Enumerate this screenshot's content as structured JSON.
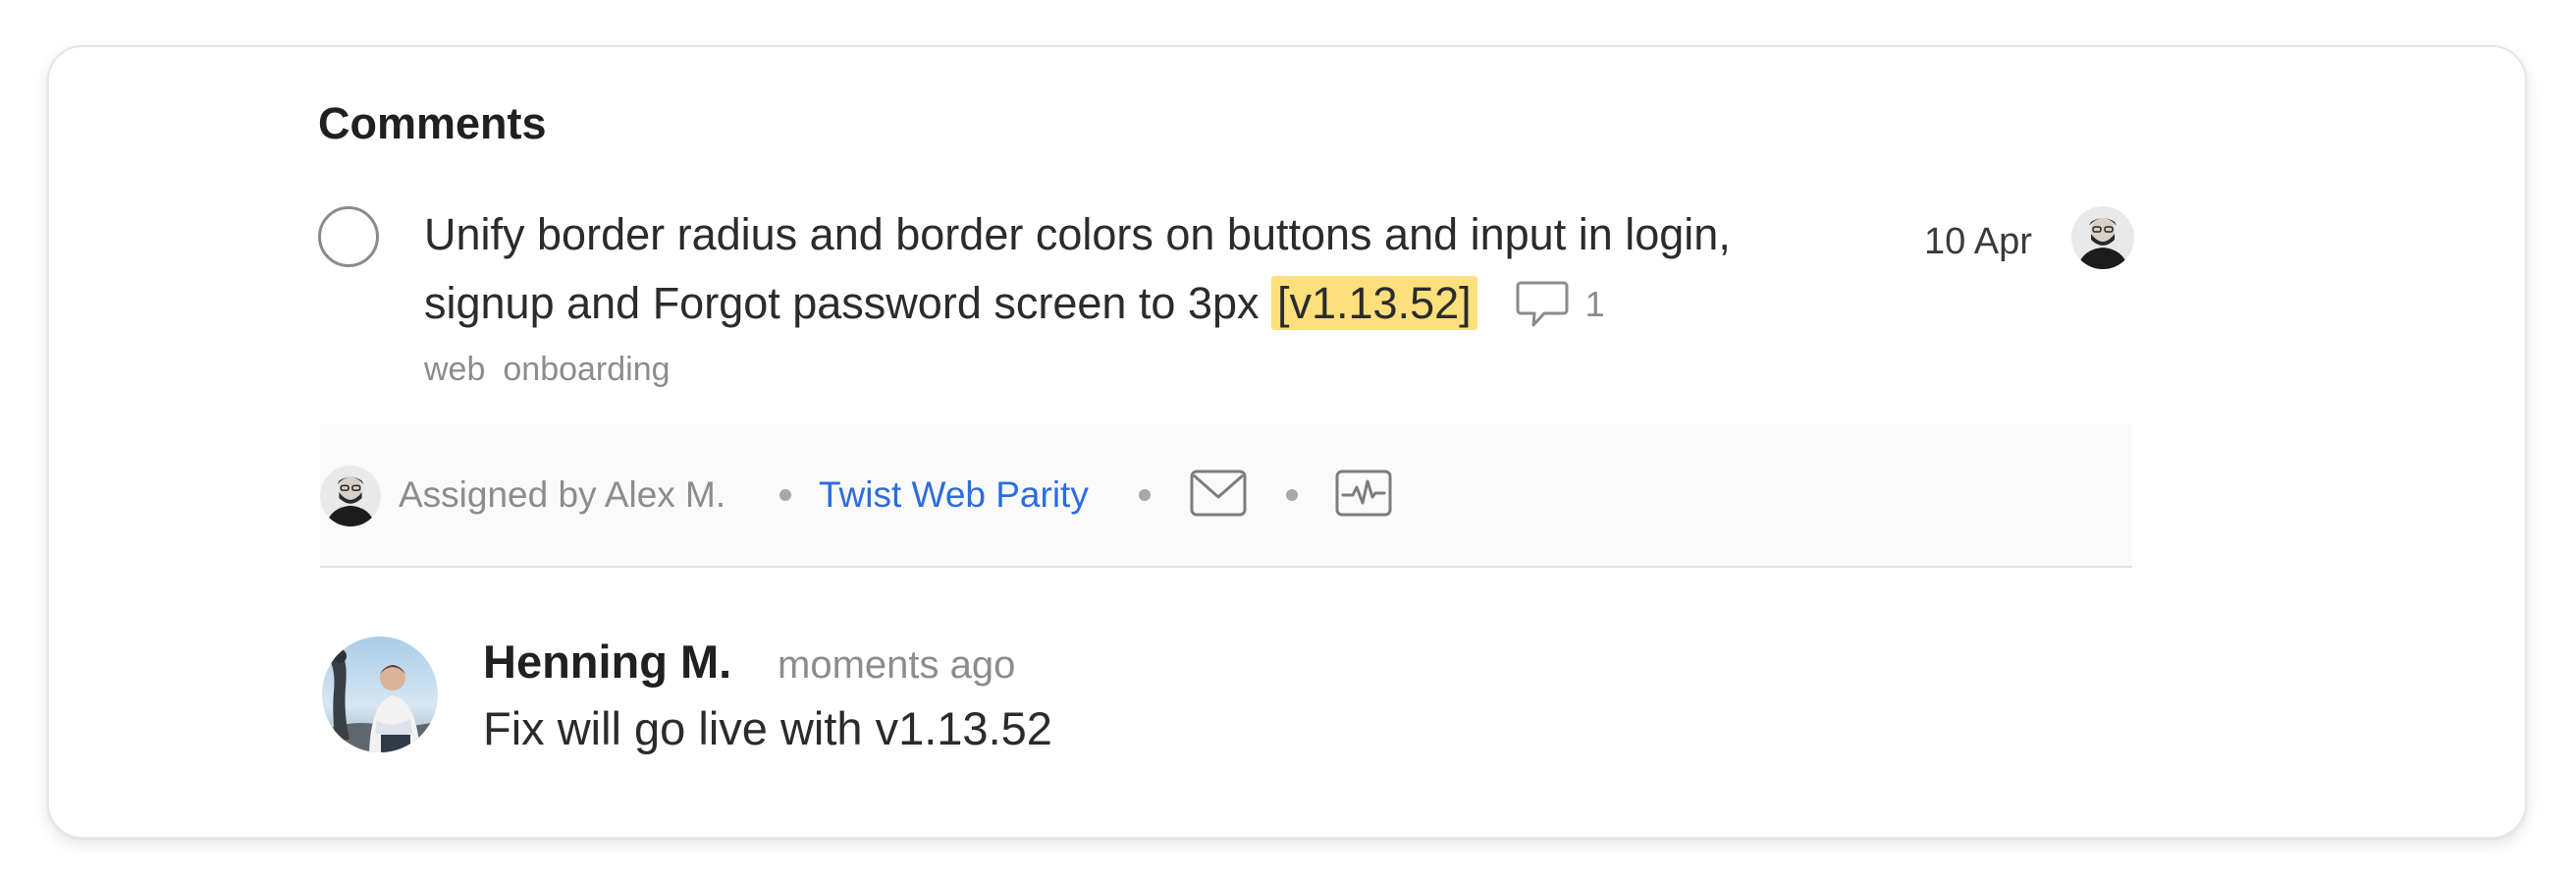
{
  "section": {
    "title": "Comments"
  },
  "task": {
    "line1": "Unify border radius and border colors on buttons and input in login,",
    "line2_prefix": "signup and Forgot password screen to 3px ",
    "version_tag": "[v1.13.52]",
    "comment_count": "1",
    "date": "10 Apr",
    "labels": [
      "web",
      "onboarding"
    ]
  },
  "meta": {
    "assigned_by": "Assigned by Alex M.",
    "project": "Twist Web Parity",
    "icons": [
      "mail-icon",
      "activity-icon"
    ]
  },
  "comment": {
    "author": "Henning M.",
    "time": "moments ago",
    "text": "Fix will go live with v1.13.52"
  },
  "colors": {
    "highlight": "#fde07c",
    "link": "#2d6cdf",
    "muted": "#8c8c8c",
    "text": "#2b2b2b"
  }
}
